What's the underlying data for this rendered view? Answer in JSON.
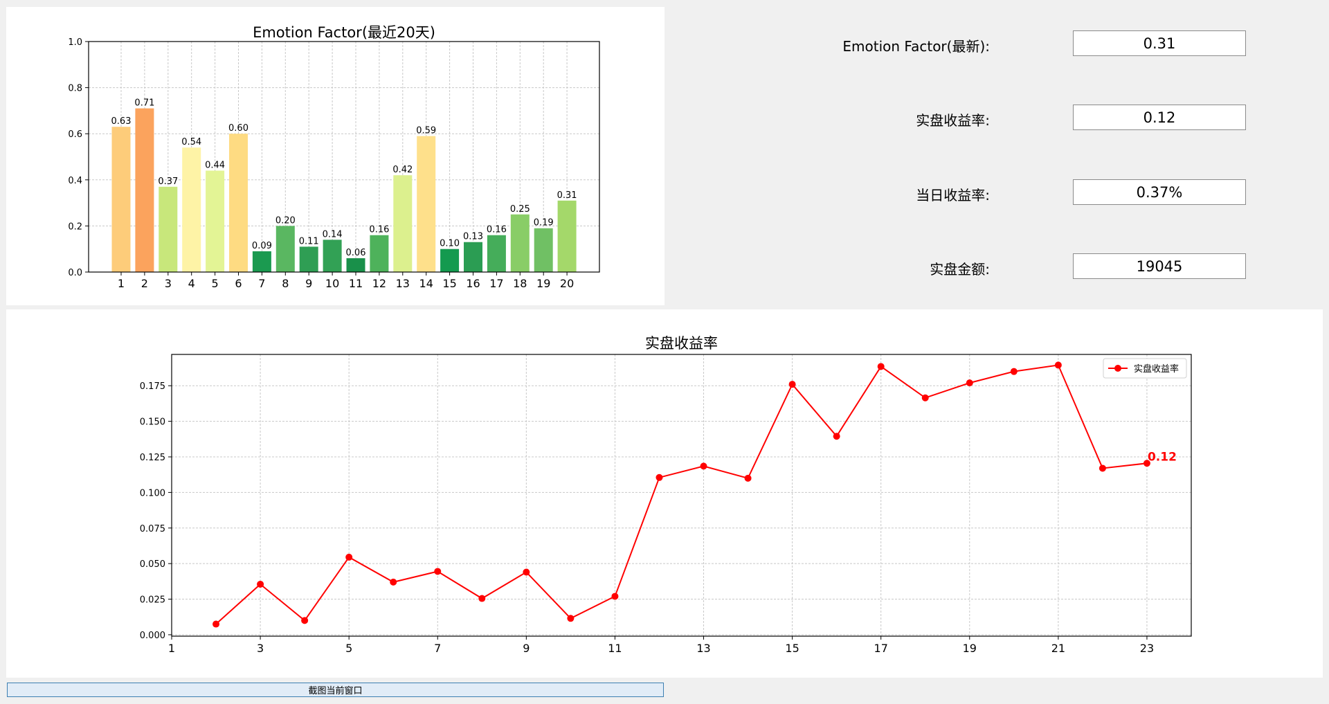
{
  "metrics": [
    {
      "label": "Emotion Factor(最新):",
      "value": "0.31"
    },
    {
      "label": "实盘收益率:",
      "value": "0.12"
    },
    {
      "label": "当日收益率:",
      "value": "0.37%"
    },
    {
      "label": "实盘金额:",
      "value": "19045"
    }
  ],
  "screenshot_button": "截图当前窗口",
  "chart_data": [
    {
      "type": "bar",
      "title": "Emotion Factor(最近20天)",
      "categories": [
        "1",
        "2",
        "3",
        "4",
        "5",
        "6",
        "7",
        "8",
        "9",
        "10",
        "11",
        "12",
        "13",
        "14",
        "15",
        "16",
        "17",
        "18",
        "19",
        "20"
      ],
      "values": [
        0.63,
        0.71,
        0.37,
        0.54,
        0.44,
        0.6,
        0.09,
        0.2,
        0.11,
        0.14,
        0.06,
        0.16,
        0.42,
        0.59,
        0.1,
        0.13,
        0.16,
        0.25,
        0.19,
        0.31
      ],
      "data_labels": [
        "0.63",
        "0.71",
        "0.37",
        "0.54",
        "0.44",
        "0.60",
        "0.09",
        "0.20",
        "0.11",
        "0.14",
        "0.06",
        "0.16",
        "0.42",
        "0.59",
        "0.10",
        "0.13",
        "0.16",
        "0.25",
        "0.19",
        "0.31"
      ],
      "ylim": [
        0,
        1.0
      ],
      "yticks": [
        "0.0",
        "0.2",
        "0.4",
        "0.6",
        "0.8",
        "1.0"
      ],
      "grid": true,
      "colors": [
        "#fdcc7a",
        "#fba35d",
        "#c8e77b",
        "#fef3a6",
        "#e3f495",
        "#fedb82",
        "#1b9a50",
        "#5ab761",
        "#2f9e54",
        "#32a155",
        "#19904a",
        "#4eb25b",
        "#dcf08e",
        "#fee08b",
        "#149a4f",
        "#2b9d53",
        "#45ad5a",
        "#89cd67",
        "#70c064",
        "#a4d86a"
      ]
    },
    {
      "type": "line",
      "title": "实盘收益率",
      "x": [
        2,
        3,
        4,
        5,
        6,
        7,
        8,
        9,
        10,
        11,
        12,
        13,
        14,
        15,
        16,
        17,
        18,
        19,
        20,
        21,
        22,
        23
      ],
      "y": [
        0.0075,
        0.0355,
        0.01,
        0.0545,
        0.037,
        0.0445,
        0.0255,
        0.044,
        0.0115,
        0.027,
        0.1105,
        0.1185,
        0.11,
        0.176,
        0.1395,
        0.1885,
        0.1665,
        0.177,
        0.185,
        0.1895,
        0.117,
        0.1205
      ],
      "xlim": [
        1,
        24
      ],
      "ylim": [
        -0.001,
        0.197
      ],
      "xticks": [
        "1",
        "3",
        "5",
        "7",
        "9",
        "11",
        "13",
        "15",
        "17",
        "19",
        "21",
        "23"
      ],
      "yticks": [
        "0.000",
        "0.025",
        "0.050",
        "0.075",
        "0.100",
        "0.125",
        "0.150",
        "0.175"
      ],
      "legend": "实盘收益率",
      "legend_position": "top-right",
      "last_label": "0.12",
      "grid": true,
      "color": "#ff0000"
    }
  ]
}
